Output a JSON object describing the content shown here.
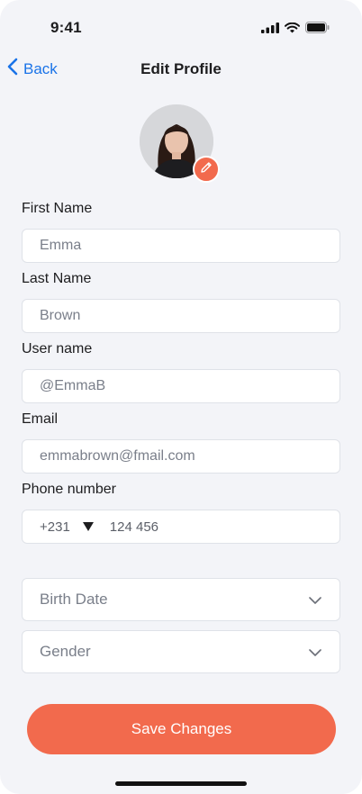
{
  "status": {
    "time": "9:41"
  },
  "nav": {
    "back_label": "Back",
    "title": "Edit Profile"
  },
  "profile": {
    "avatar_icon": "person-photo",
    "edit_icon": "pencil-icon",
    "badge_color": "#f26a4d"
  },
  "form": {
    "first_name": {
      "label": "First Name",
      "value": "Emma"
    },
    "last_name": {
      "label": "Last Name",
      "value": "Brown"
    },
    "username": {
      "label": "User name",
      "value": "@EmmaB"
    },
    "email": {
      "label": "Email",
      "value": "emmabrown@fmail.com"
    },
    "phone": {
      "label": "Phone number",
      "country_code": "+231",
      "value": "124 456"
    },
    "birth_date": {
      "placeholder": "Birth Date"
    },
    "gender": {
      "placeholder": "Gender"
    }
  },
  "actions": {
    "save_label": "Save Changes",
    "accent": "#f26a4d",
    "link_color": "#1a73e8"
  }
}
